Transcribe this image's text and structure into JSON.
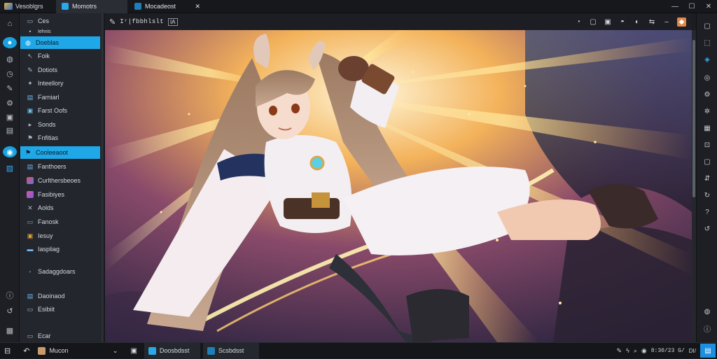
{
  "titlebar": {
    "app_name": "Vesoblgrs",
    "tabs": [
      {
        "label": "Momotrs",
        "active": true
      },
      {
        "label": "Mocadeost",
        "active": false
      }
    ],
    "tab_close": "✕"
  },
  "window_controls": {
    "minimize": "—",
    "maximize": "☐",
    "close": "✕"
  },
  "rail_icons": [
    "home-icon",
    "chat-icon",
    "globe-icon",
    "clock-icon",
    "wrench-icon",
    "gear-icon",
    "image-icon",
    "layers-icon",
    "chat-bubble-icon",
    "photo-icon",
    "info-icon",
    "history-icon",
    "folder-icon"
  ],
  "sidebar": {
    "items": [
      {
        "label": "Ces",
        "icon": "folder-icon"
      },
      {
        "label": "Iehnis",
        "icon": "dot-icon"
      },
      {
        "label": "Doeblas",
        "icon": "globe-icon",
        "selected": true
      },
      {
        "label": "Foik",
        "icon": "cursor-icon"
      },
      {
        "label": "Dotiots",
        "icon": "wrench-icon"
      },
      {
        "label": "Inteellory",
        "icon": "spark-icon"
      },
      {
        "label": "Farniarl",
        "icon": "panel-icon"
      },
      {
        "label": "Farst Oofs",
        "icon": "image-icon"
      },
      {
        "label": "Sonds",
        "icon": "pen-icon"
      },
      {
        "label": "Fnfitias",
        "icon": "flag-icon"
      },
      {
        "label": "Cooleeaoot",
        "icon": "flag-icon",
        "selected": true
      },
      {
        "label": "Fanthoers",
        "icon": "panel-icon"
      },
      {
        "label": "Curlthersbeoes",
        "icon": "color-icon"
      },
      {
        "label": "Fasibiyes",
        "icon": "color-icon"
      },
      {
        "label": "Aolds",
        "icon": "grid-icon"
      },
      {
        "label": "Fanosk",
        "icon": "window-icon"
      },
      {
        "label": "Iesuy",
        "icon": "lock-icon"
      },
      {
        "label": "Iaspliag",
        "icon": "window-icon"
      },
      {
        "label": "Sadaggdoars",
        "icon": "circle-icon"
      },
      {
        "label": "Daoinaod",
        "icon": "panel-icon"
      },
      {
        "label": "Esibiit",
        "icon": "panel-icon"
      },
      {
        "label": "Ecar",
        "icon": "panel-icon"
      }
    ]
  },
  "toolbar": {
    "path": "Iʳ|fbbhlslt",
    "path_badge": "IA",
    "icons": [
      "pin-icon",
      "note-icon",
      "save-icon",
      "flag-icon",
      "palette-icon",
      "share-icon",
      "minus-icon",
      "color-swatch-icon"
    ]
  },
  "right_rail_icons": [
    "square-icon",
    "export-icon",
    "layers-blue-icon",
    "camera-icon",
    "gear-icon",
    "settings-icon",
    "grid-icon",
    "crop-icon",
    "square-icon",
    "swap-icon",
    "refresh-icon",
    "help-icon",
    "history-icon",
    "globe-icon",
    "info-icon",
    "grid-icon",
    "settings-icon"
  ],
  "taskbar": {
    "start_icon": "layout-icon",
    "back_icon": "back-icon",
    "project": "Mucon",
    "tasks": [
      {
        "label": "Doosbdsst"
      },
      {
        "label": "Scsbdsst"
      }
    ],
    "clock": "8:30/23 G/",
    "tray_text": "DI/",
    "accent_notify": "#1c8fe0"
  },
  "colors": {
    "accent_blue": "#1ea8e8",
    "dark_bg": "#1b1d22",
    "sidebar_bg": "#23262c"
  }
}
